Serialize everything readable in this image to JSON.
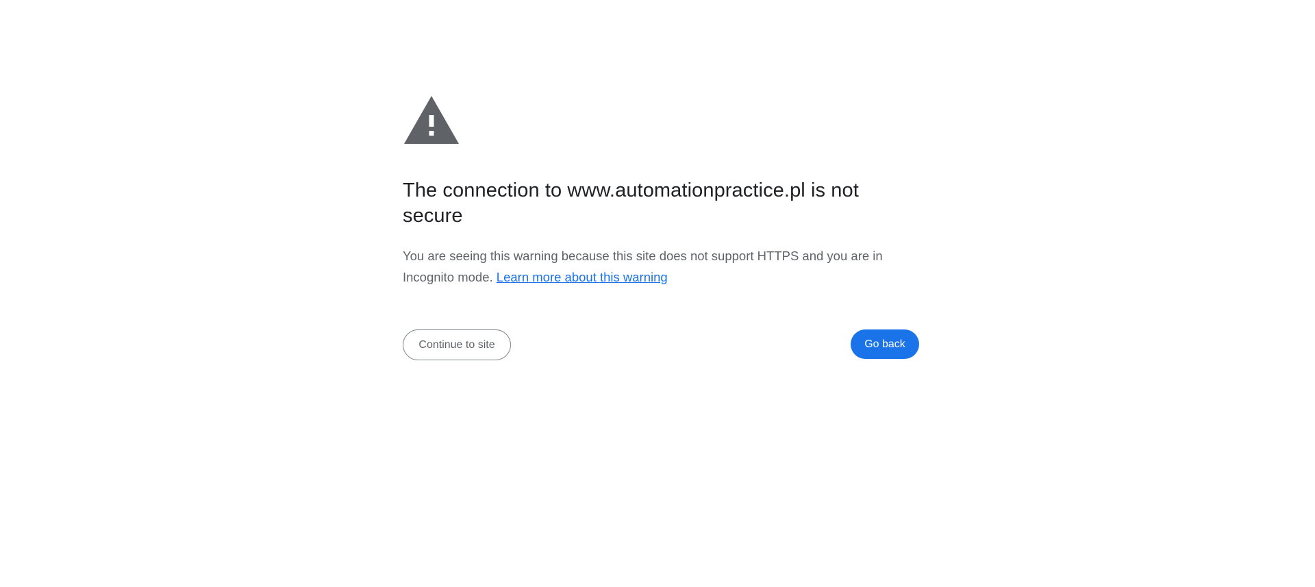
{
  "icon": "warning-triangle-icon",
  "colors": {
    "icon": "#5f6368",
    "title": "#202124",
    "body_text": "#5f6368",
    "link": "#1a73e8",
    "primary_button": "#1a73e8",
    "secondary_button_border": "#80868b"
  },
  "heading": "The connection to www.automationpractice.pl is not secure",
  "message": {
    "text": "You are seeing this warning because this site does not support HTTPS and you are in Incognito mode.",
    "link_label": "Learn more about this warning"
  },
  "buttons": {
    "continue_label": "Continue to site",
    "back_label": "Go back"
  }
}
